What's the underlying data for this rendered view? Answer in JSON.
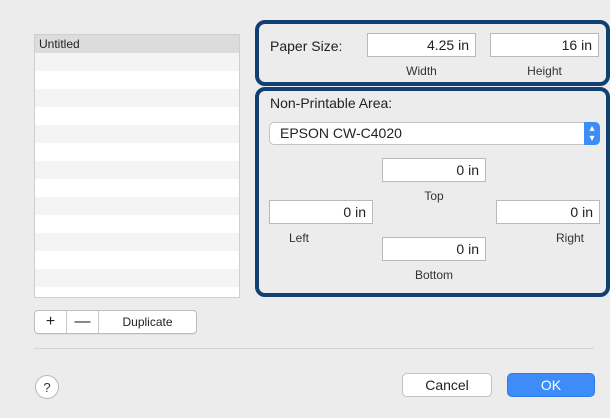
{
  "paper_list": {
    "items": [
      "Untitled"
    ]
  },
  "paper_size": {
    "label": "Paper Size:",
    "width_value": "4.25 in",
    "width_label": "Width",
    "height_value": "16 in",
    "height_label": "Height"
  },
  "non_printable": {
    "label": "Non-Printable Area:",
    "printer": "EPSON CW-C4020",
    "top_value": "0 in",
    "top_label": "Top",
    "left_value": "0 in",
    "left_label": "Left",
    "right_value": "0 in",
    "right_label": "Right",
    "bottom_value": "0 in",
    "bottom_label": "Bottom"
  },
  "list_controls": {
    "add_label": "+",
    "remove_label": "—",
    "duplicate_label": "Duplicate"
  },
  "footer": {
    "help_label": "?",
    "cancel_label": "Cancel",
    "ok_label": "OK"
  },
  "colors": {
    "accent": "#3e8cf7",
    "highlight": "#123f73"
  }
}
